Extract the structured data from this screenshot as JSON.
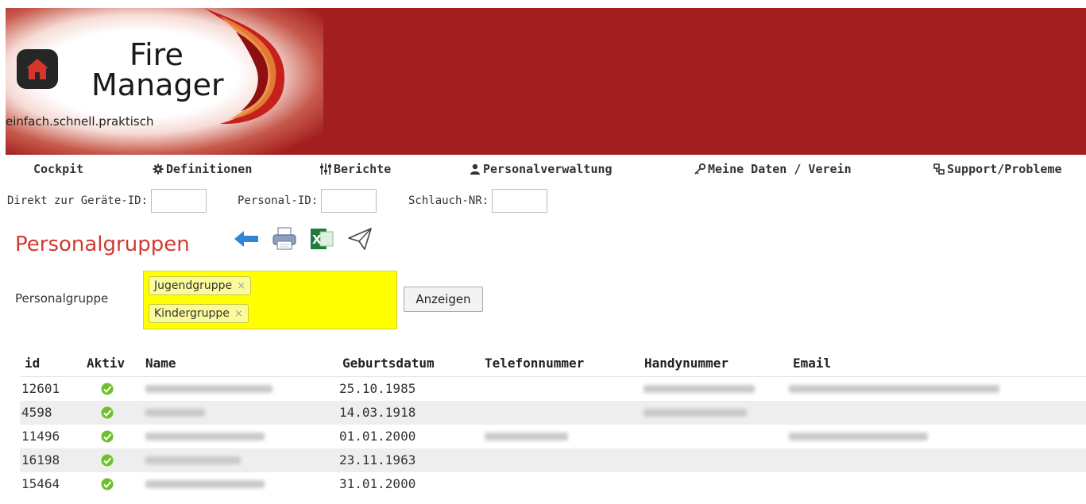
{
  "header": {
    "logo_line1": "Fire",
    "logo_line2": "Manager",
    "slogan": "einfach.schnell.praktisch",
    "home_icon": "home-icon"
  },
  "nav": [
    {
      "label": "Cockpit",
      "icon": ""
    },
    {
      "label": "Definitionen",
      "icon": "gear-icon"
    },
    {
      "label": "Berichte",
      "icon": "sliders-icon"
    },
    {
      "label": "Personalverwaltung",
      "icon": "person-icon"
    },
    {
      "label": "Meine Daten / Verein",
      "icon": "key-icon"
    },
    {
      "label": "Support/Probleme",
      "icon": "support-icon"
    }
  ],
  "quick_search": {
    "device_label": "Direkt zur Geräte-ID:",
    "person_label": "Personal-ID:",
    "hose_label": "Schlauch-NR:"
  },
  "page": {
    "title": "Personalgruppen",
    "tools": [
      "back-arrow-icon",
      "print-icon",
      "excel-icon",
      "send-icon"
    ]
  },
  "filter": {
    "label": "Personalgruppe",
    "tags": [
      "Jugendgruppe",
      "Kindergruppe"
    ],
    "remove_glyph": "×",
    "button": "Anzeigen"
  },
  "table": {
    "columns": [
      "id",
      "Aktiv",
      "Name",
      "Geburtsdatum",
      "Telefonnummer",
      "Handynummer",
      "Email"
    ],
    "rows": [
      {
        "id": "12601",
        "aktiv": true,
        "geburtsdatum": "25.10.1985"
      },
      {
        "id": "4598",
        "aktiv": true,
        "geburtsdatum": "14.03.1918"
      },
      {
        "id": "11496",
        "aktiv": true,
        "geburtsdatum": "01.01.2000"
      },
      {
        "id": "16198",
        "aktiv": true,
        "geburtsdatum": "23.11.1963"
      },
      {
        "id": "15464",
        "aktiv": true,
        "geburtsdatum": "31.01.2000"
      }
    ]
  },
  "colors": {
    "banner": "#a31e1e",
    "title": "#d23a32",
    "filter_highlight": "#ffff00",
    "active_check": "#6fbf2a"
  }
}
